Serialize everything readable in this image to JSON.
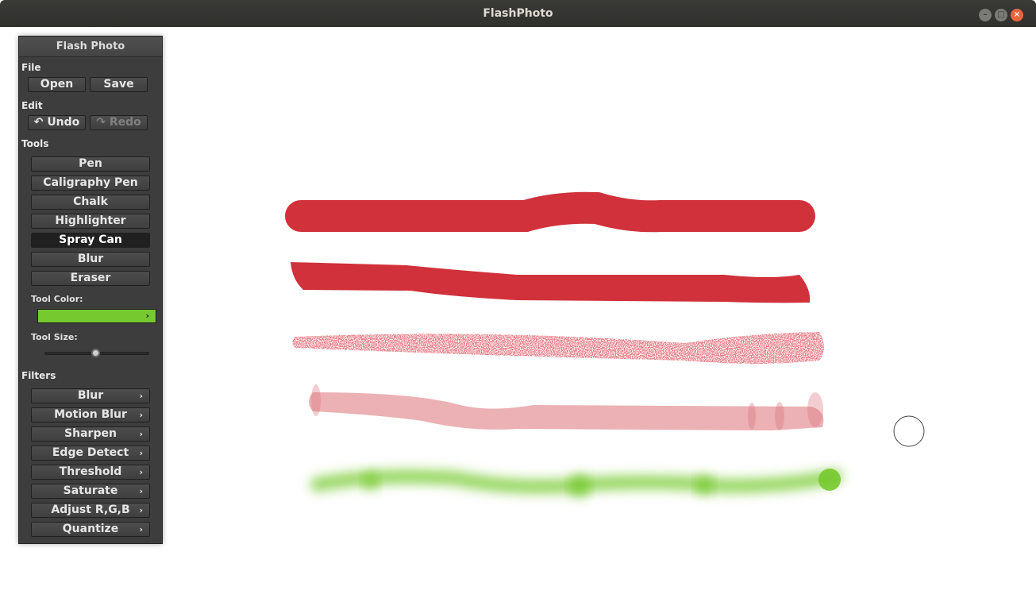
{
  "window": {
    "title": "FlashPhoto"
  },
  "panel": {
    "title": "Flash Photo",
    "file": {
      "label": "File",
      "open": "Open",
      "save": "Save"
    },
    "edit": {
      "label": "Edit",
      "undo": "Undo",
      "redo": "Redo",
      "undo_icon": "undo-arrow-icon",
      "redo_icon": "redo-arrow-icon"
    },
    "tools": {
      "label": "Tools",
      "items": [
        "Pen",
        "Caligraphy Pen",
        "Chalk",
        "Highlighter",
        "Spray Can",
        "Blur",
        "Eraser"
      ],
      "selected": "Spray Can"
    },
    "tool_color": {
      "label": "Tool Color:",
      "value": "#76c92e"
    },
    "tool_size": {
      "label": "Tool Size:",
      "level": 0.49
    },
    "filters": {
      "label": "Filters",
      "items": [
        "Blur",
        "Motion Blur",
        "Sharpen",
        "Edge Detect",
        "Threshold",
        "Saturate",
        "Adjust R,G,B",
        "Quantize"
      ]
    }
  },
  "canvas": {
    "stroke_colors": {
      "red": "#d0313a",
      "highlighter": "#e8a3a7",
      "green": "#76c92e"
    }
  }
}
